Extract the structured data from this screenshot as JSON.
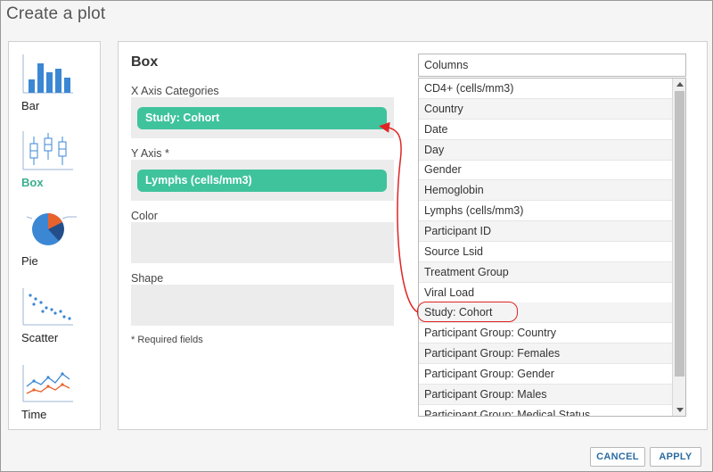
{
  "dialog": {
    "title": "Create a plot"
  },
  "plot_types": [
    {
      "label": "Bar",
      "icon": "bar-chart-icon",
      "active": false
    },
    {
      "label": "Box",
      "icon": "box-plot-icon",
      "active": true
    },
    {
      "label": "Pie",
      "icon": "pie-chart-icon",
      "active": false
    },
    {
      "label": "Scatter",
      "icon": "scatter-plot-icon",
      "active": false
    },
    {
      "label": "Time",
      "icon": "time-chart-icon",
      "active": false
    }
  ],
  "config": {
    "heading": "Box",
    "fields": [
      {
        "label": "X Axis Categories",
        "value": "Study: Cohort"
      },
      {
        "label": "Y Axis *",
        "value": "Lymphs (cells/mm3)"
      },
      {
        "label": "Color",
        "value": ""
      },
      {
        "label": "Shape",
        "value": ""
      }
    ],
    "required_note": "* Required fields"
  },
  "columns": {
    "header": "Columns",
    "items": [
      "CD4+ (cells/mm3)",
      "Country",
      "Date",
      "Day",
      "Gender",
      "Hemoglobin",
      "Lymphs (cells/mm3)",
      "Participant ID",
      "Source Lsid",
      "Treatment Group",
      "Viral Load",
      "Study: Cohort",
      "Participant Group: Country",
      "Participant Group: Females",
      "Participant Group: Gender",
      "Participant Group: Males",
      "Participant Group: Medical Status"
    ],
    "highlighted": "Study: Cohort"
  },
  "buttons": {
    "cancel": "CANCEL",
    "apply": "APPLY"
  },
  "colors": {
    "accent": "#3fc39d",
    "annotation": "#e02424",
    "link": "#2b6ca3"
  }
}
